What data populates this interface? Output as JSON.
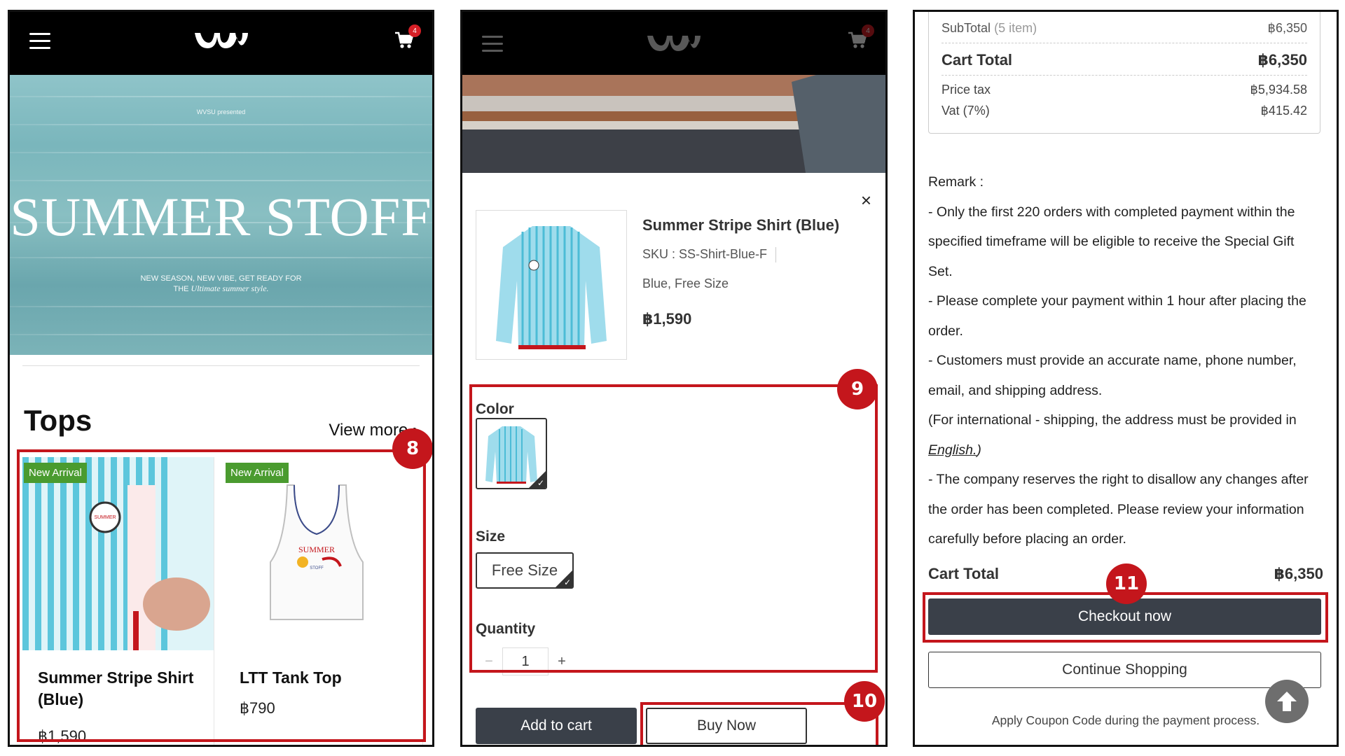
{
  "colors": {
    "accent_red": "#c4161c",
    "dark_button": "#3a4049",
    "new_arrival_green": "#4a9b2f"
  },
  "header": {
    "cart_count": "4",
    "menu_icon": "hamburger-menu-icon",
    "cart_icon": "shopping-cart-icon"
  },
  "panel1": {
    "hero": {
      "presented": "WVSU presented",
      "title": "SUMMER STOFF",
      "tagline_1": "NEW SEASON, NEW VIBE, GET READY FOR",
      "tagline_2_plain": "THE ",
      "tagline_2_italic": "Ultimate summer style."
    },
    "section_title": "Tops",
    "view_more": "View more",
    "products": [
      {
        "badge": "New Arrival",
        "name": "Summer Stripe Shirt (Blue)",
        "price": "฿1,590"
      },
      {
        "badge": "New Arrival",
        "name": "LTT Tank Top",
        "price": "฿790"
      }
    ],
    "callout": "8"
  },
  "panel2": {
    "product": {
      "title": "Summer Stripe Shirt (Blue)",
      "sku": "SKU : SS-Shirt-Blue-F",
      "variant": "Blue, Free Size",
      "price": "฿1,590"
    },
    "color_label": "Color",
    "size_label": "Size",
    "size_value": "Free Size",
    "quantity_label": "Quantity",
    "quantity_value": "1",
    "qty_minus": "−",
    "qty_plus": "+",
    "add_to_cart": "Add to cart",
    "buy_now": "Buy Now",
    "close": "×",
    "callout_9": "9",
    "callout_10": "10"
  },
  "panel3": {
    "subtotal_label": "SubTotal",
    "subtotal_count": "(5 item)",
    "subtotal_value": "฿6,350",
    "cart_total_label": "Cart Total",
    "cart_total_value": "฿6,350",
    "price_tax_label": "Price tax",
    "price_tax_value": "฿5,934.58",
    "vat_label": "Vat (7%)",
    "vat_value": "฿415.42",
    "remark_title": "Remark :",
    "remark_1": "- Only the first 220 orders with completed payment within the specified timeframe will be eligible to receive the Special Gift Set.",
    "remark_2": "- Please complete your payment within 1 hour after placing the order.",
    "remark_3": "- Customers must provide an accurate name, phone number, email, and shipping address.",
    "remark_4_a": "(For international - shipping, the address must be provided in ",
    "remark_4_link": "English.",
    "remark_4_b": ")",
    "remark_5": "- The company reserves the right to disallow any changes after the order has been completed. Please review your information carefully before placing an order.",
    "bottom_total_label": "Cart Total",
    "bottom_total_value": "฿6,350",
    "checkout": "Checkout now",
    "continue": "Continue Shopping",
    "coupon_note": "Apply Coupon Code during the payment process.",
    "callout_11": "11"
  }
}
